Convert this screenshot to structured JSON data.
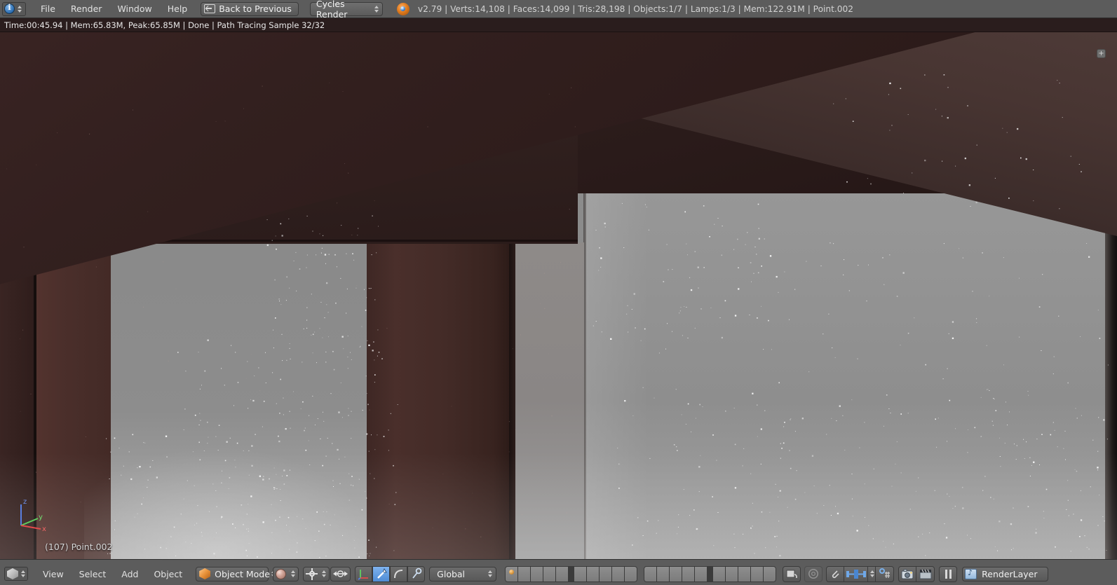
{
  "topbar": {
    "editor_type_icon": "info-editor-icon",
    "menus": [
      "File",
      "Render",
      "Window",
      "Help"
    ],
    "back_button": {
      "label": "Back to Previous",
      "icon": "back-to-previous-icon"
    },
    "render_engine": {
      "label": "Cycles Render",
      "icon": "chevron-updown-icon"
    },
    "blender_logo": "blender-logo-icon",
    "stats": "v2.79 | Verts:14,108 | Faces:14,099 | Tris:28,198 | Objects:1/7 | Lamps:1/3 | Mem:122.91M | Point.002",
    "stats_fields": {
      "version": "v2.79",
      "verts": "Verts:14,108",
      "faces": "Faces:14,099",
      "tris": "Tris:28,198",
      "objects": "Objects:1/7",
      "lamps": "Lamps:1/3",
      "mem": "Mem:122.91M",
      "active_object": "Point.002"
    }
  },
  "render_status": {
    "text": "Time:00:45.94 | Mem:65.83M, Peak:65.85M | Done | Path Tracing Sample 32/32",
    "fields": {
      "time": "Time:00:45.94",
      "mem": "Mem:65.83M, Peak:65.85M",
      "state": "Done",
      "progress": "Path Tracing Sample 32/32",
      "samples_done": 32,
      "samples_total": 32
    }
  },
  "viewport": {
    "object_name_overlay": "(107) Point.002",
    "axis_gizmo": {
      "x_label": "x",
      "y_label": "y",
      "z_label": "z",
      "x_color": "#e24b4b",
      "y_color": "#5fd05f",
      "z_color": "#5a7fe0"
    },
    "scene_description": "Cycles path-traced render of a dark brown wooden table corner against a light gray wall",
    "colors": {
      "wall_light": "#9a9a9a",
      "wall_shadow": "#8a8a8a",
      "table_dark": "#2b1a19",
      "table_apron": "#483532",
      "leg_front": "#4b2f2b"
    },
    "view_nub": "+"
  },
  "bottombar": {
    "editor_type_icon": "3d-view-editor-icon",
    "menus": [
      "View",
      "Select",
      "Add",
      "Object"
    ],
    "mode_select": {
      "label": "Object Mode",
      "icon": "object-mode-cube-icon"
    },
    "shading_select": {
      "icon": "viewport-shading-rendered-icon"
    },
    "pivot_select": {
      "icon": "pivot-center-icon"
    },
    "snap_toggle": {
      "icon": "proportional-edit-icon"
    },
    "manipulators": [
      {
        "name": "translate-manipulator",
        "icon": "axis-arrows-icon",
        "active": false
      },
      {
        "name": "rotate-manipulator",
        "icon": "arrow-manipulator-icon",
        "active": true
      },
      {
        "name": "scale-manipulator",
        "icon": "rotate-arc-icon",
        "active": false
      },
      {
        "name": "scale-handle-manipulator",
        "icon": "scale-handle-icon",
        "active": false
      }
    ],
    "transform_orientation": {
      "label": "Global",
      "icon": "chevron-updown-icon"
    },
    "layers": {
      "group_a_top": [
        true,
        false,
        false,
        false,
        false
      ],
      "group_a_bottom": [
        false,
        false,
        false,
        false,
        false
      ],
      "group_b_top": [
        false,
        false,
        false,
        false,
        false
      ],
      "group_b_bottom": [
        false,
        false,
        false,
        false,
        false
      ],
      "active_layer_index": 0
    },
    "buttons": [
      {
        "name": "lock-scene-to-object-button",
        "icon": "scene-lock-icon"
      },
      {
        "name": "texture-solid-button",
        "icon": "circle-outline-icon"
      },
      {
        "name": "render-preview-button",
        "icon": "clip-icon"
      },
      {
        "name": "bone-axes-button",
        "icon": "bone-axes-icon"
      },
      {
        "name": "snap-during-transform-button",
        "icon": "magnet-grid-icon"
      },
      {
        "name": "render-image-button",
        "icon": "camera-icon"
      },
      {
        "name": "render-animation-button",
        "icon": "clapperboard-icon"
      },
      {
        "name": "pause-render-button",
        "icon": "pause-icon"
      }
    ],
    "render_layer": {
      "label": "RenderLayer",
      "icon": "render-layer-icon"
    }
  }
}
